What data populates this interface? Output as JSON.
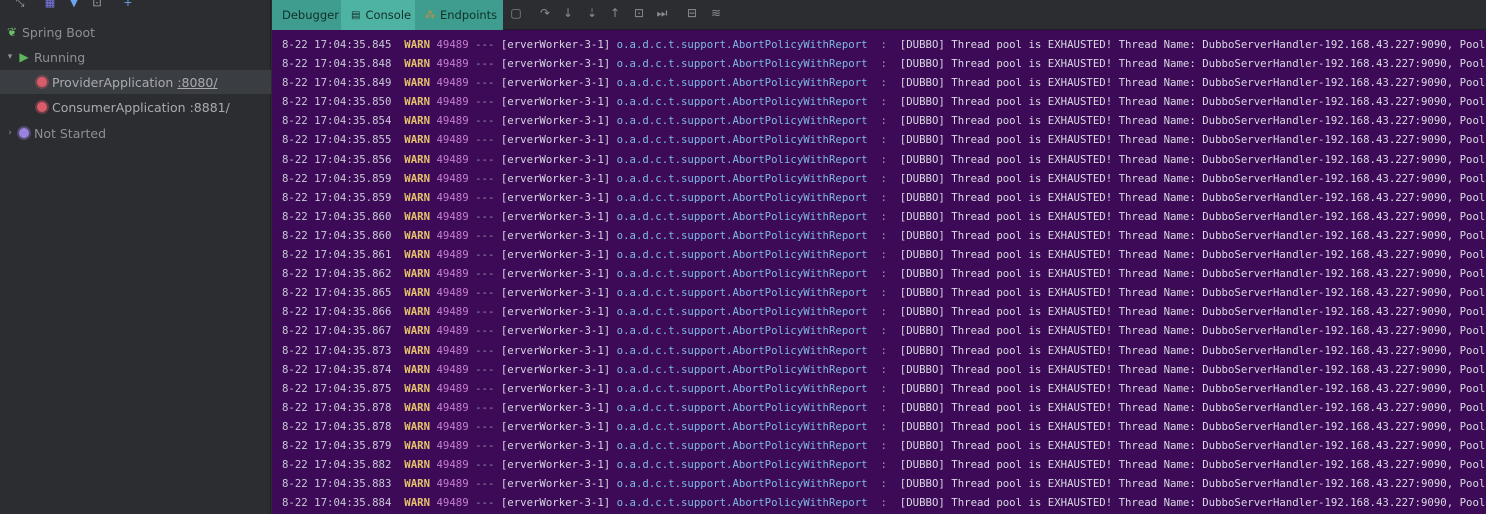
{
  "left_panel": {
    "tree": [
      {
        "label": "Spring Boot",
        "icon": "spring-leaf-icon"
      },
      {
        "label": "Running",
        "icon": "run-triangle-icon",
        "chevron": "▾"
      },
      {
        "label": "ProviderApplication",
        "port": ":8080/",
        "icon": "app-gear-icon",
        "selected": true
      },
      {
        "label": "ConsumerApplication",
        "port": ":8881/",
        "icon": "app-gear-icon"
      },
      {
        "label": "Not Started",
        "icon": "not-started-gear-icon",
        "chevron": "›"
      }
    ]
  },
  "toolbar": {
    "tabs": [
      {
        "label": "Debugger"
      },
      {
        "label": "Console"
      },
      {
        "label": "Endpoints"
      }
    ],
    "icons": [
      "stop-frame-icon",
      "step-over-icon",
      "step-into-icon",
      "force-step-into-icon",
      "step-out-icon",
      "run-to-cursor-icon",
      "resume-icon",
      "evaluate-icon",
      "settings-icon"
    ]
  },
  "colors": {
    "console_bg": "#3c0a57",
    "warn": "#e6c26b",
    "pid": "#c77dd1",
    "logger": "#7fb8e6",
    "tab_active": "#4fb3a4"
  },
  "console": {
    "common": {
      "level": "WARN",
      "pid": "49489",
      "dashes": "---",
      "thread": "[erverWorker-3-1]",
      "logger": "o.a.d.c.t.support.AbortPolicyWithReport",
      "sep": ":",
      "message": "[DUBBO] Thread pool is EXHAUSTED! Thread Name: DubboServerHandler-192.168.43.227:9090, Pool Siz"
    },
    "timestamps": [
      "8-22 17:04:35.845",
      "8-22 17:04:35.848",
      "8-22 17:04:35.849",
      "8-22 17:04:35.850",
      "8-22 17:04:35.854",
      "8-22 17:04:35.855",
      "8-22 17:04:35.856",
      "8-22 17:04:35.859",
      "8-22 17:04:35.859",
      "8-22 17:04:35.860",
      "8-22 17:04:35.860",
      "8-22 17:04:35.861",
      "8-22 17:04:35.862",
      "8-22 17:04:35.865",
      "8-22 17:04:35.866",
      "8-22 17:04:35.867",
      "8-22 17:04:35.873",
      "8-22 17:04:35.874",
      "8-22 17:04:35.875",
      "8-22 17:04:35.878",
      "8-22 17:04:35.878",
      "8-22 17:04:35.879",
      "8-22 17:04:35.882",
      "8-22 17:04:35.883",
      "8-22 17:04:35.884"
    ]
  }
}
